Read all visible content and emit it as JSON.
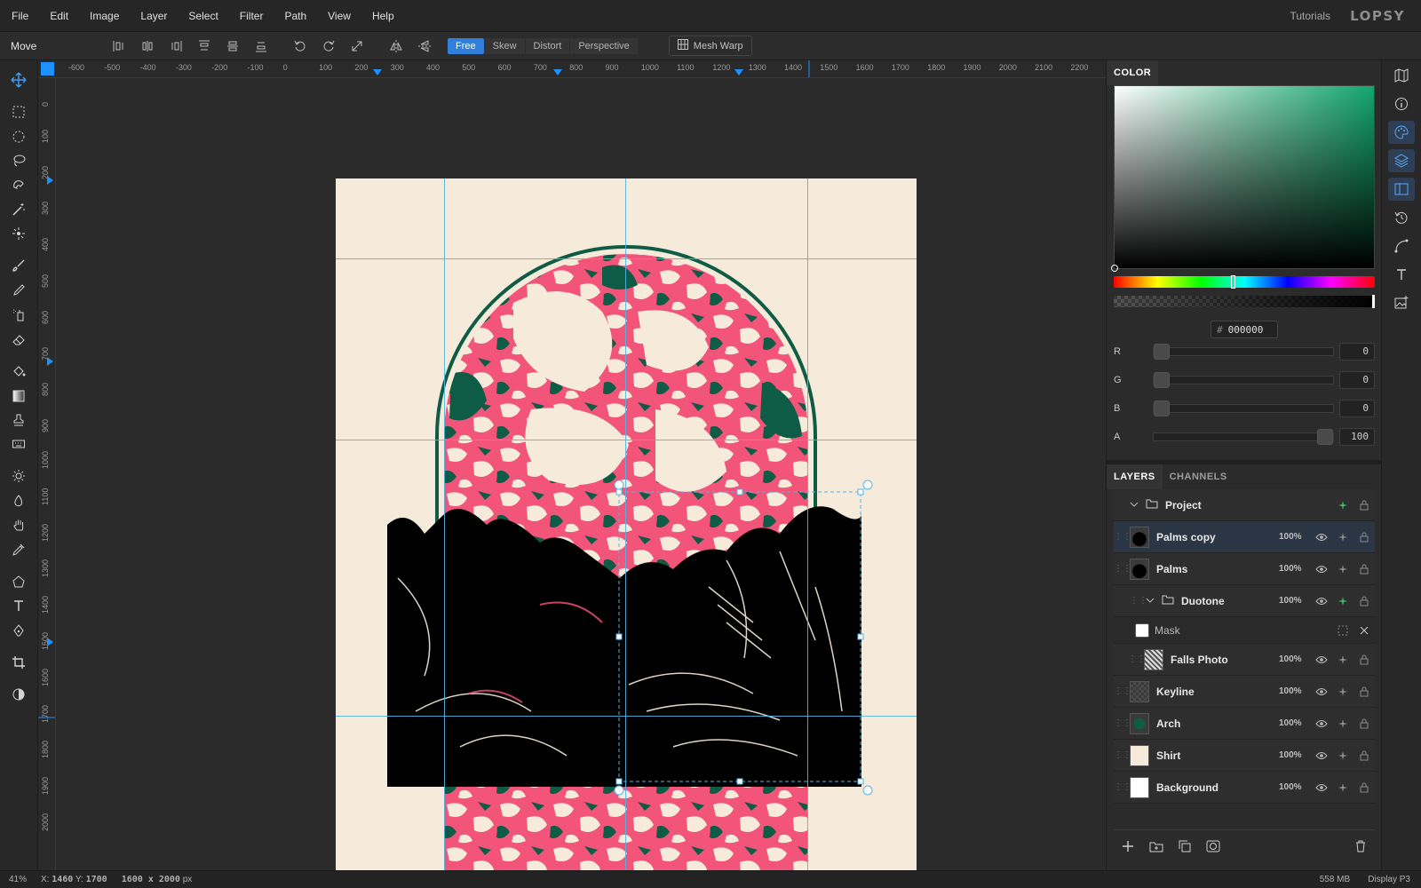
{
  "menu": [
    "File",
    "Edit",
    "Image",
    "Layer",
    "Select",
    "Filter",
    "Path",
    "View",
    "Help"
  ],
  "header": {
    "tutorials": "Tutorials",
    "logo": "LOPSY"
  },
  "toolbar": {
    "tool_name": "Move",
    "modes": [
      "Free",
      "Skew",
      "Distort",
      "Perspective"
    ],
    "mesh_warp": "Mesh Warp"
  },
  "ruler": {
    "h_labels": [
      "-600",
      "-500",
      "-400",
      "-300",
      "-200",
      "-100",
      "0",
      "100",
      "200",
      "300",
      "400",
      "500",
      "600",
      "700",
      "800",
      "900",
      "1000",
      "1100",
      "1200",
      "1300",
      "1400",
      "1500",
      "1600",
      "1700",
      "1800",
      "1900",
      "2000",
      "2100",
      "2200"
    ],
    "v_labels": [
      "0",
      "100",
      "200",
      "300",
      "400",
      "500",
      "600",
      "700",
      "800",
      "900",
      "1000",
      "1100",
      "1200",
      "1300",
      "1400",
      "1500",
      "1600",
      "1700",
      "1800",
      "1900",
      "2000"
    ]
  },
  "color_panel": {
    "title": "COLOR",
    "hex": "000000",
    "hex_prefix": "#",
    "channels": [
      {
        "label": "R",
        "value": "0",
        "level": 0
      },
      {
        "label": "G",
        "value": "0",
        "level": 0
      },
      {
        "label": "B",
        "value": "0",
        "level": 0
      },
      {
        "label": "A",
        "value": "100",
        "level": 1
      }
    ],
    "hue_level": 0.45,
    "accent": "#13a56f"
  },
  "layers_panel": {
    "tabs": [
      "LAYERS",
      "CHANNELS"
    ],
    "layers": [
      {
        "name": "Project",
        "opacity": "",
        "type": "group",
        "indent": 0,
        "selected": false
      },
      {
        "name": "Palms copy",
        "opacity": "100%",
        "type": "layer",
        "indent": 0,
        "selected": true
      },
      {
        "name": "Palms",
        "opacity": "100%",
        "type": "layer",
        "indent": 0,
        "selected": false
      },
      {
        "name": "Duotone",
        "opacity": "100%",
        "type": "group",
        "indent": 1,
        "selected": false
      },
      {
        "name": "Mask",
        "opacity": "",
        "type": "mask",
        "indent": 1,
        "selected": false
      },
      {
        "name": "Falls Photo",
        "opacity": "100%",
        "type": "layer",
        "indent": 2,
        "selected": false
      },
      {
        "name": "Keyline",
        "opacity": "100%",
        "type": "layer",
        "indent": 0,
        "selected": false
      },
      {
        "name": "Arch",
        "opacity": "100%",
        "type": "layer",
        "indent": 0,
        "selected": false
      },
      {
        "name": "Shirt",
        "opacity": "100%",
        "type": "layer",
        "indent": 0,
        "selected": false
      },
      {
        "name": "Background",
        "opacity": "100%",
        "type": "layer",
        "indent": 0,
        "selected": false
      }
    ]
  },
  "status": {
    "zoom": "41%",
    "x_label": "X:",
    "x": "1460",
    "y_label": "Y:",
    "y": "1700",
    "dims": "1600 x 2000",
    "dims_unit": "px",
    "memory": "558 MB",
    "profile": "Display P3"
  },
  "colors": {
    "pink": "#f2547a",
    "green": "#0e5c45",
    "cream": "#f6ebdb",
    "guide": "#4fb6e6"
  }
}
